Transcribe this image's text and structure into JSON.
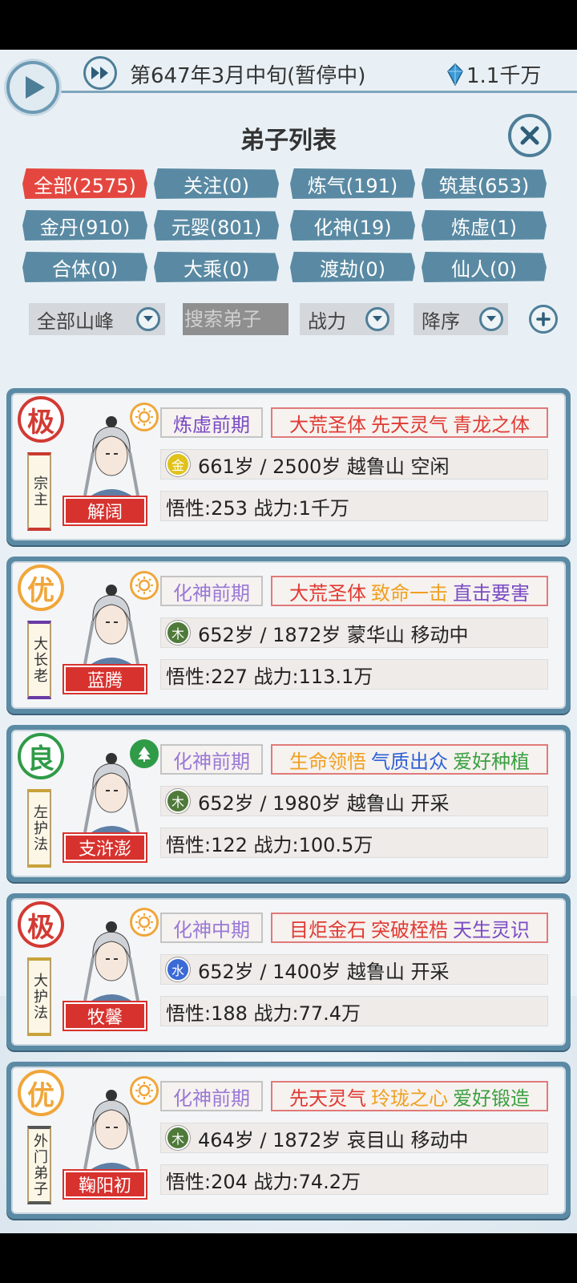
{
  "header": {
    "date": "第647年3月中旬(暂停中)",
    "money": "1.1千万",
    "title": "弟子列表"
  },
  "filters": [
    {
      "label": "全部(2575)",
      "active": true
    },
    {
      "label": "关注(0)"
    },
    {
      "label": "炼气(191)"
    },
    {
      "label": "筑基(653)"
    },
    {
      "label": "金丹(910)"
    },
    {
      "label": "元婴(801)"
    },
    {
      "label": "化神(19)"
    },
    {
      "label": "炼虚(1)"
    },
    {
      "label": "合体(0)"
    },
    {
      "label": "大乘(0)"
    },
    {
      "label": "渡劫(0)"
    },
    {
      "label": "仙人(0)"
    }
  ],
  "controls": {
    "peak": "全部山峰",
    "search_placeholder": "搜索弟子",
    "sort_by": "战力",
    "order": "降序"
  },
  "colors": {
    "accent": "#5a8aa3",
    "active_tag": "#e4473f",
    "realm_purple": "#7a4bc4",
    "trait_red": "#e03b34",
    "trait_orange": "#f0a020",
    "trait_green": "#3aa041",
    "trait_blue": "#2f62d6"
  },
  "disciples": [
    {
      "grade": "极",
      "grade_class": "ji",
      "role": "宗主",
      "role_class": "",
      "name": "解阔",
      "realm": "炼虚前期",
      "realm_color": "#7a4bc4",
      "traits": [
        {
          "text": "大荒圣体",
          "color": "#e03b34"
        },
        {
          "text": "先天灵气",
          "color": "#e03b34"
        },
        {
          "text": "青龙之体",
          "color": "#e03b34"
        }
      ],
      "element": "金",
      "element_color": "#e0c21a",
      "info": "661岁 / 2500岁  越鲁山  空闲",
      "stats": "悟性:253  战力:1千万",
      "badge": "sun-icon"
    },
    {
      "grade": "优",
      "grade_class": "you",
      "role": "大长老",
      "role_class": "purple",
      "name": "蓝腾",
      "realm": "化神前期",
      "realm_color": "#9a78d6",
      "traits": [
        {
          "text": "大荒圣体",
          "color": "#e03b34"
        },
        {
          "text": "致命一击",
          "color": "#f0a020"
        },
        {
          "text": "直击要害",
          "color": "#7a4bc4"
        }
      ],
      "element": "木",
      "element_color": "#4f7a3a",
      "info": "652岁 / 1872岁  蒙华山  移动中",
      "stats": "悟性:227  战力:113.1万",
      "badge": "sun-icon"
    },
    {
      "grade": "良",
      "grade_class": "liang",
      "role": "左护法",
      "role_class": "gold",
      "name": "支浒澎",
      "realm": "化神前期",
      "realm_color": "#9a78d6",
      "traits": [
        {
          "text": "生命领悟",
          "color": "#f0a020"
        },
        {
          "text": "气质出众",
          "color": "#2f62d6"
        },
        {
          "text": "爱好种植",
          "color": "#3aa041"
        }
      ],
      "element": "木",
      "element_color": "#4f7a3a",
      "info": "652岁 / 1980岁  越鲁山  开采",
      "stats": "悟性:122  战力:100.5万",
      "badge": "tree-icon"
    },
    {
      "grade": "极",
      "grade_class": "ji",
      "role": "大护法",
      "role_class": "gold",
      "name": "牧馨",
      "realm": "化神中期",
      "realm_color": "#9a78d6",
      "traits": [
        {
          "text": "目炬金石",
          "color": "#e03b34"
        },
        {
          "text": "突破桎梏",
          "color": "#e03b34"
        },
        {
          "text": "天生灵识",
          "color": "#7a4bc4"
        }
      ],
      "element": "水",
      "element_color": "#3a6ad6",
      "info": "652岁 / 1400岁  越鲁山  开采",
      "stats": "悟性:188  战力:77.4万",
      "badge": "sun-icon"
    },
    {
      "grade": "优",
      "grade_class": "you",
      "role": "外门弟子",
      "role_class": "gray",
      "name": "鞠阳初",
      "realm": "化神前期",
      "realm_color": "#9a78d6",
      "traits": [
        {
          "text": "先天灵气",
          "color": "#e03b34"
        },
        {
          "text": "玲珑之心",
          "color": "#f0a020"
        },
        {
          "text": "爱好锻造",
          "color": "#3aa041"
        }
      ],
      "element": "木",
      "element_color": "#4f7a3a",
      "info": "464岁 / 1872岁  哀目山  移动中",
      "stats": "悟性:204  战力:74.2万",
      "badge": "sun-icon"
    }
  ]
}
